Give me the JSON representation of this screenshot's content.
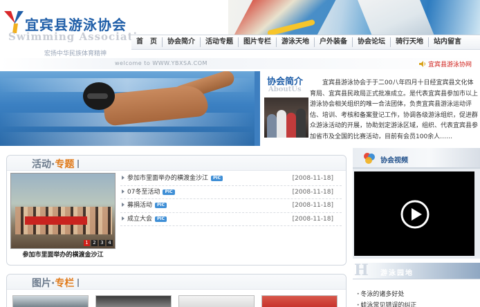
{
  "header": {
    "title": "宜宾县游泳协会",
    "title_en": "Swimming Association",
    "slogan": "宏扬中华民族体育精神",
    "welcome": "welcome to WWW.YBXSA.COM",
    "marquee": "宜宾县游泳协网"
  },
  "nav": {
    "items": [
      {
        "label": "首　页"
      },
      {
        "label": "协会简介"
      },
      {
        "label": "活动专题"
      },
      {
        "label": "图片专栏"
      },
      {
        "label": "游泳天地"
      },
      {
        "label": "户外装备"
      },
      {
        "label": "协会论坛"
      },
      {
        "label": "骑行天地"
      },
      {
        "label": "站内留言"
      }
    ]
  },
  "intro": {
    "heading": "协会简介",
    "heading_en": "AboutUs",
    "text": "宜宾县游泳协会于于二00八年四月十日经宜宾县文化体育局、宜宾县民政局正式批准成立。是代表宜宾县参加市以上游泳协会相关组织的唯一合法团体，负责宜宾县游泳运动评估、培训、考核和备案登记工作，协调各级游泳组织，促进群众游泳活动的开展，协助划定游泳区域，组织、代表宜宾县参加省市及全国的比赛活动，目前有会员100余人……"
  },
  "activity": {
    "title_part1": "活动·",
    "title_part2": "专题",
    "caption": "参加市里面举办的横渡金沙江",
    "pager": [
      "1",
      "2",
      "3",
      "4"
    ],
    "pic_badge": "PIC",
    "items": [
      {
        "title": "参加市里面举办的横渡金沙江",
        "date": "[2008-11-18]"
      },
      {
        "title": "07冬至活动",
        "date": "[2008-11-18]"
      },
      {
        "title": "募捐活动",
        "date": "[2008-11-18]"
      },
      {
        "title": "成立大会",
        "date": "[2008-11-18]"
      }
    ]
  },
  "pictures": {
    "title_part1": "图片·",
    "title_part2": "专栏"
  },
  "video": {
    "title": "协会视频"
  },
  "swim_garden": {
    "letter": "H",
    "title": "游泳园地",
    "items": [
      {
        "title": "冬泳的诸多好处"
      },
      {
        "title": "蛙泳常见错误的纠正"
      }
    ]
  },
  "colors": {
    "brand_blue": "#1f5ea8",
    "accent_orange": "#e07a1a",
    "marquee_red": "#d0201a"
  }
}
